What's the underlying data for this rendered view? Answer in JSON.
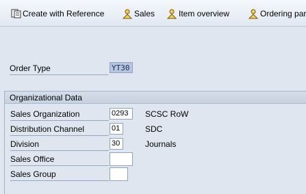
{
  "toolbar": {
    "create_with_reference": "Create with Reference",
    "sales": "Sales",
    "item_overview": "Item overview",
    "ordering_party": "Ordering par"
  },
  "order": {
    "label": "Order Type",
    "value": "YT30"
  },
  "org_data": {
    "title": "Organizational Data",
    "fields": [
      {
        "label": "Sales Organization",
        "value": "0293",
        "desc": "SCSC RoW"
      },
      {
        "label": "Distribution Channel",
        "value": "01",
        "desc": "SDC"
      },
      {
        "label": "Division",
        "value": "30",
        "desc": "Journals"
      },
      {
        "label": "Sales Office",
        "value": "",
        "desc": ""
      },
      {
        "label": "Sales Group",
        "value": "",
        "desc": ""
      }
    ]
  }
}
